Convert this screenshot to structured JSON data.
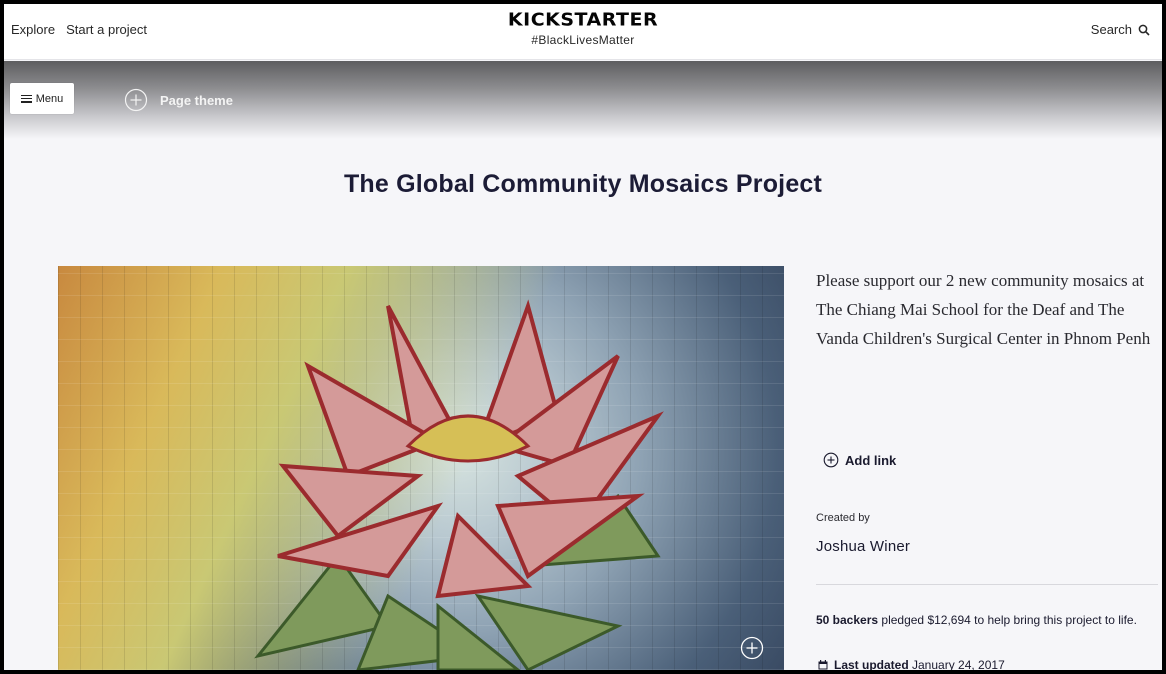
{
  "nav": {
    "explore": "Explore",
    "start_project": "Start a project",
    "logo": "KICKSTARTER",
    "hashtag": "#BlackLivesMatter",
    "search": "Search"
  },
  "editor": {
    "menu_label": "Menu",
    "page_theme_label": "Page theme"
  },
  "project": {
    "title": "The Global Community Mosaics Project",
    "blurb": "Please support our 2 new community mosaics at The Chiang Mai School for the Deaf and The Vanda Children's Surgical Center in Phnom Penh",
    "add_link_label": "Add link",
    "created_by_label": "Created by",
    "creator": "Joshua Winer",
    "backers_count": "50 backers",
    "backers_text": " pledged $12,694 to help bring this project to life.",
    "last_updated_label": "Last updated",
    "last_updated_date": " January 24, 2017"
  },
  "colors": {
    "background": "#f6f6f9",
    "text": "#1a1a2e",
    "nav_bg": "#ffffff"
  },
  "icons": [
    "hamburger-icon",
    "plus-circle-icon",
    "search-icon",
    "calendar-icon"
  ]
}
